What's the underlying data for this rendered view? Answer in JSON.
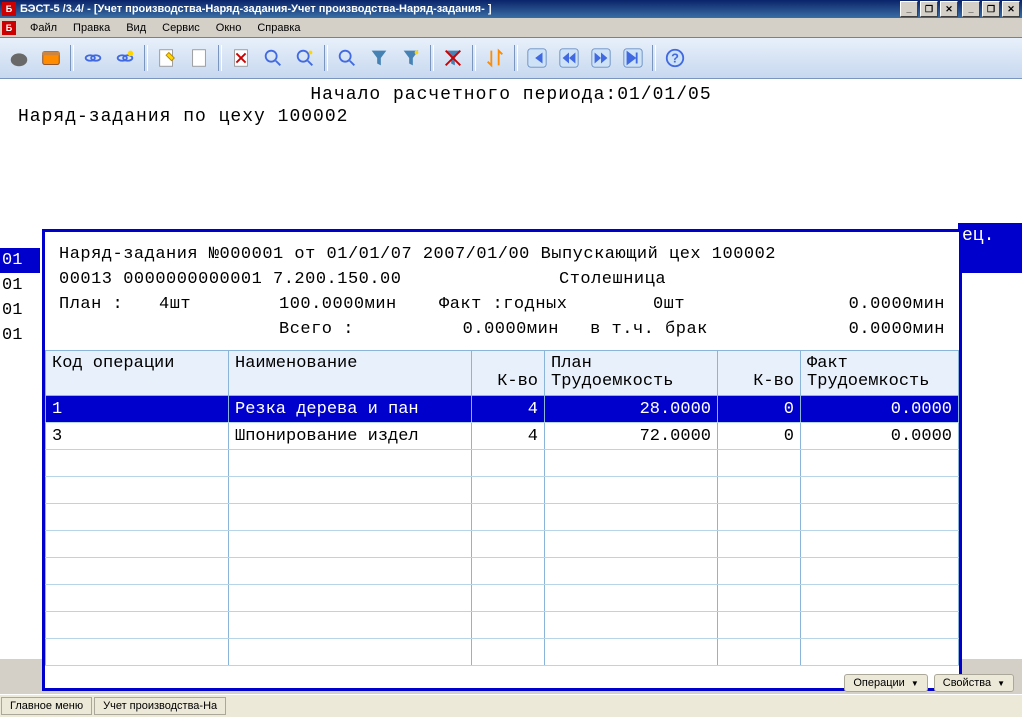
{
  "window": {
    "title": "БЭСТ-5 /3.4/ - [Учет производства-Наряд-задания-Учет производства-Наряд-задания- ]"
  },
  "menu": {
    "file": "Файл",
    "edit": "Правка",
    "view": "Вид",
    "service": "Сервис",
    "window": "Окно",
    "help": "Справка"
  },
  "header": {
    "period": "Начало расчетного периода:01/01/05",
    "subtitle": "Наряд-задания по цеху 100002"
  },
  "left_codes": [
    "01",
    "01",
    "01",
    "01"
  ],
  "ec_label": "ец.",
  "panel": {
    "line1": "Наряд-задания №000001 от 01/01/07 2007/01/00 Выпускающий цех 100002",
    "line2_left": "00013 0000000000001 7.200.150.00",
    "line2_right": "Столешница",
    "line3_plan": "План :",
    "line3_qty": "4шт",
    "line3_time": "100.0000мин",
    "line3_fact": "Факт :годных",
    "line3_factqty": "0шт",
    "line3_facttime": "0.0000мин",
    "line4_total": "Всего :",
    "line4_totaltime": "0.0000мин",
    "line4_brak": "в т.ч. брак",
    "line4_braktime": "0.0000мин"
  },
  "table": {
    "headers": {
      "code": "Код операции",
      "name": "Наименование",
      "qty": "К-во",
      "plan": "План Трудоемкость",
      "qty2": "К-во",
      "fact": "Факт Трудоемкость"
    },
    "rows": [
      {
        "code": "1",
        "name": "Резка дерева и пан",
        "qty": "4",
        "plan": "28.0000",
        "qty2": "0",
        "fact": "0.0000"
      },
      {
        "code": "3",
        "name": "Шпонирование издел",
        "qty": "4",
        "plan": "72.0000",
        "qty2": "0",
        "fact": "0.0000"
      }
    ]
  },
  "footer": {
    "operations": "Операции",
    "properties": "Свойства"
  },
  "status": {
    "main": "Главное меню",
    "tab1": "Учет производства-На"
  }
}
